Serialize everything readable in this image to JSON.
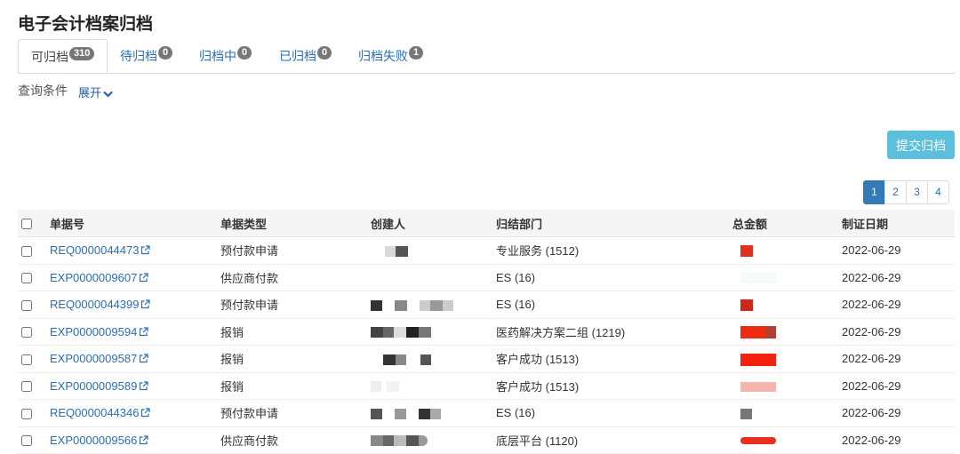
{
  "page_title": "电子会计档案归档",
  "tabs": [
    {
      "label": "可归档",
      "count": "310",
      "active": true
    },
    {
      "label": "待归档",
      "count": "0",
      "active": false
    },
    {
      "label": "归档中",
      "count": "0",
      "active": false
    },
    {
      "label": "已归档",
      "count": "0",
      "active": false
    },
    {
      "label": "归档失败",
      "count": "1",
      "active": false
    }
  ],
  "query": {
    "label": "查询条件",
    "expand_label": "展开"
  },
  "submit_label": "提交归档",
  "pagination": {
    "pages": [
      "1",
      "2",
      "3",
      "4"
    ],
    "current": "1"
  },
  "table": {
    "columns": [
      "单据号",
      "单据类型",
      "创建人",
      "归结部门",
      "总金额",
      "制证日期"
    ],
    "rows": [
      {
        "doc_no": "REQ0000044473",
        "type": "预付款申请",
        "dept": "专业服务 (1512)",
        "date": "2022-06-29"
      },
      {
        "doc_no": "EXP0000009607",
        "type": "供应商付款",
        "dept": "ES (16)",
        "date": "2022-06-29"
      },
      {
        "doc_no": "REQ0000044399",
        "type": "预付款申请",
        "dept": "ES (16)",
        "date": "2022-06-29"
      },
      {
        "doc_no": "EXP0000009594",
        "type": "报销",
        "dept": "医药解决方案二组 (1219)",
        "date": "2022-06-29"
      },
      {
        "doc_no": "EXP0000009587",
        "type": "报销",
        "dept": "客户成功 (1513)",
        "date": "2022-06-29"
      },
      {
        "doc_no": "EXP0000009589",
        "type": "报销",
        "dept": "客户成功 (1513)",
        "date": "2022-06-29"
      },
      {
        "doc_no": "REQ0000044346",
        "type": "预付款申请",
        "dept": "ES (16)",
        "date": "2022-06-29"
      },
      {
        "doc_no": "EXP0000009566",
        "type": "供应商付款",
        "dept": "底层平台 (1120)",
        "date": "2022-06-29"
      }
    ]
  },
  "colors": {
    "link": "#2a6eb5",
    "primary": "#337ab7",
    "submit": "#5bc0de",
    "badge": "#777777",
    "redaction_red": "#e8301c"
  }
}
